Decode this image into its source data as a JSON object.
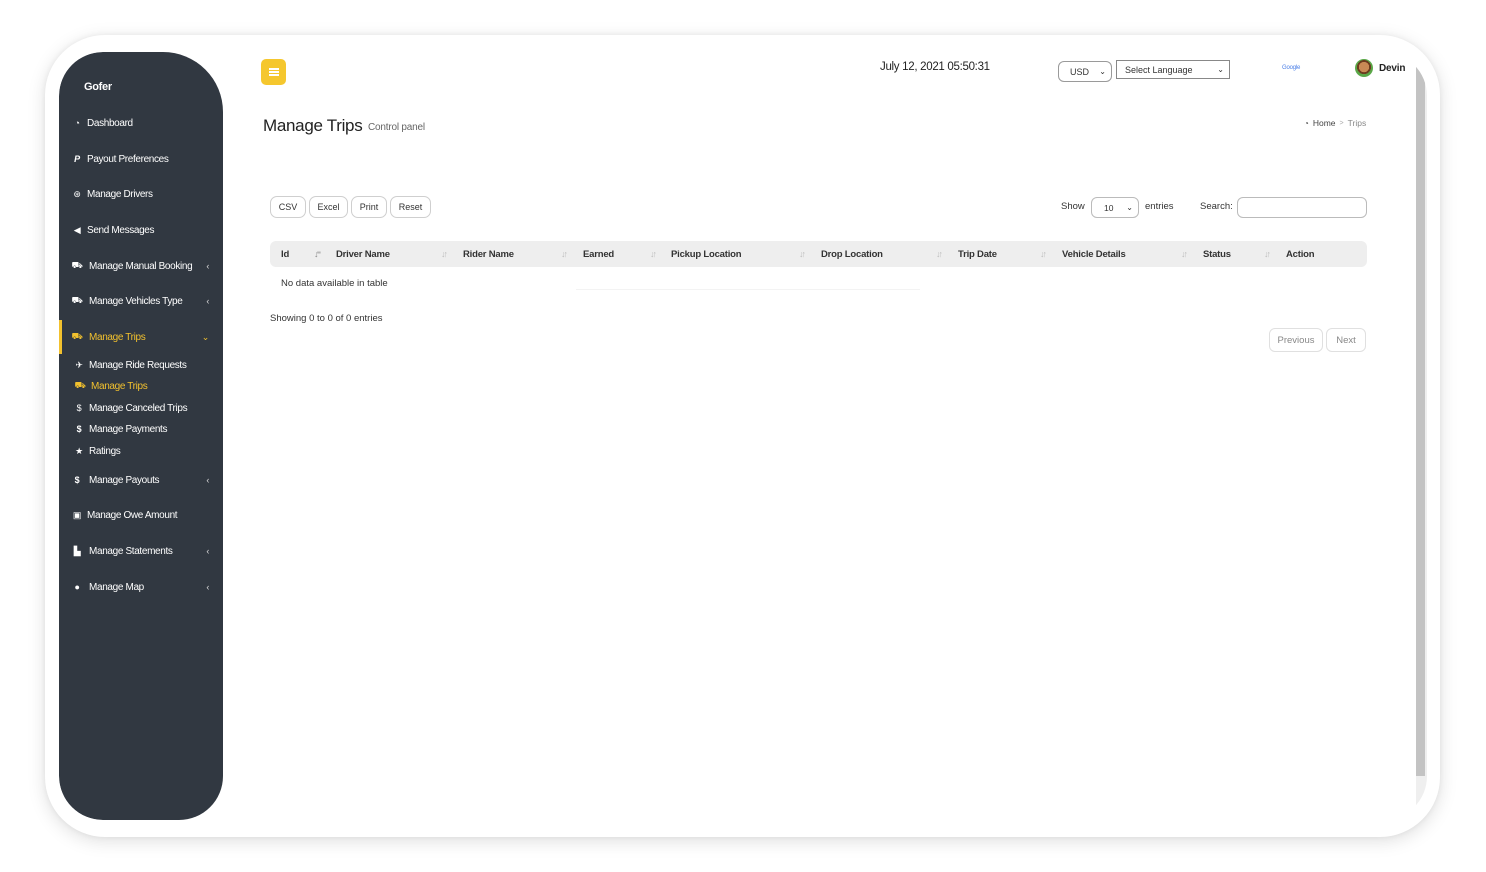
{
  "app": {
    "brand": "Gofer"
  },
  "sidebar": {
    "items": [
      {
        "label": "Dashboard",
        "icon": "dashboard-icon",
        "glyph": "◔",
        "has_chevron": false
      },
      {
        "label": "Payout Preferences",
        "icon": "paypal-icon",
        "glyph": "P",
        "has_chevron": false
      },
      {
        "label": "Manage Drivers",
        "icon": "life-ring-icon",
        "glyph": "⊛",
        "has_chevron": false
      },
      {
        "label": "Send Messages",
        "icon": "bullhorn-icon",
        "glyph": "📢",
        "has_chevron": false
      },
      {
        "label": "Manage Manual Booking",
        "icon": "car-icon",
        "glyph": "🚘",
        "has_chevron": true
      },
      {
        "label": "Manage Vehicles Type",
        "icon": "car-icon",
        "glyph": "🚘",
        "has_chevron": true
      },
      {
        "label": "Manage Trips",
        "icon": "taxi-icon",
        "glyph": "🚖",
        "has_chevron": true,
        "expanded": true,
        "active": true
      },
      {
        "label": "Manage Payouts",
        "icon": "dollar-icon",
        "glyph": "$",
        "has_chevron": true
      },
      {
        "label": "Manage Owe Amount",
        "icon": "money-bill-icon",
        "glyph": "▣",
        "has_chevron": false
      },
      {
        "label": "Manage Statements",
        "icon": "area-chart-icon",
        "glyph": "▙",
        "has_chevron": true
      },
      {
        "label": "Manage Map",
        "icon": "map-marker-icon",
        "glyph": "●",
        "has_chevron": true
      }
    ],
    "chevron_collapsed": "‹",
    "chevron_expanded": "⌄",
    "sub_items": [
      {
        "label": "Manage Ride Requests",
        "icon": "paper-plane-icon",
        "glyph": "✈"
      },
      {
        "label": "Manage Trips",
        "icon": "taxi-icon",
        "glyph": "🚖",
        "active": true
      },
      {
        "label": "Manage Canceled Trips",
        "icon": "canceled-money-icon",
        "glyph": "$"
      },
      {
        "label": "Manage Payments",
        "icon": "dollar-icon",
        "glyph": "$"
      },
      {
        "label": "Ratings",
        "icon": "star-icon",
        "glyph": "★"
      }
    ]
  },
  "topbar": {
    "menu_icon": "hamburger-icon",
    "datetime": "July 12, 2021 05:50:31",
    "currency": "USD",
    "language_placeholder": "Select Language",
    "google_label": "Google",
    "user_name": "Devin"
  },
  "page": {
    "title": "Manage Trips",
    "subtitle": "Control panel",
    "breadcrumb": {
      "home": "Home",
      "separator": ">",
      "current": "Trips"
    }
  },
  "table_tools": {
    "export_buttons": [
      "CSV",
      "Excel",
      "Print",
      "Reset"
    ],
    "show_label": "Show",
    "page_length": "10",
    "entries_label": "entries",
    "search_label": "Search:",
    "search_value": ""
  },
  "table": {
    "columns": [
      "Id",
      "Driver Name",
      "Rider Name",
      "Earned",
      "Pickup Location",
      "Drop Location",
      "Trip Date",
      "Vehicle Details",
      "Status",
      "Action"
    ],
    "sorted_column": "Id",
    "rows": [],
    "empty_message": "No data available in table",
    "info": "Showing 0 to 0 of 0 entries",
    "pagination": {
      "previous": "Previous",
      "next": "Next"
    }
  },
  "colors": {
    "accent": "#f2c12e",
    "sidebar_bg": "#313841",
    "table_header_bg": "#eeeeee"
  }
}
